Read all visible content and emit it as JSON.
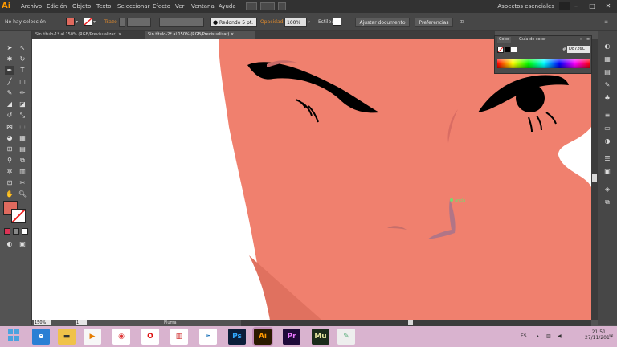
{
  "app": {
    "logo": "Ai",
    "menu": [
      "Archivo",
      "Edición",
      "Objeto",
      "Texto",
      "Seleccionar",
      "Efecto",
      "Ver",
      "Ventana",
      "Ayuda"
    ],
    "workspace": "Aspectos esenciales"
  },
  "control": {
    "selection": "No hay selección",
    "fill_color": "#E06A5E",
    "stroke_label": "Trazo",
    "brush": "Redondo 5 pt.",
    "opacity_label": "Opacidad:",
    "opacity_value": "100%",
    "style_label": "Estilo:",
    "adjust_button": "Ajustar documento",
    "prefs_button": "Preferencias"
  },
  "tabs": [
    {
      "label": "Sin título-1* al 150% (RGB/Previsualizar)",
      "close": "×"
    },
    {
      "label": "Sin título-2* al 150% (RGB/Previsualizar)",
      "close": "×"
    }
  ],
  "color_panel": {
    "tabs": [
      "Color",
      "Guía de color"
    ],
    "hex_symbol": "#",
    "hex_value": "D8726C"
  },
  "status": {
    "zoom": "150%",
    "page": "1",
    "tool": "Pluma"
  },
  "canvas": {
    "skin": "#F0806E",
    "shadow": "#E0715F",
    "anchor_label": "ancla"
  },
  "taskbar": {
    "lang": "ES",
    "time": "21:51",
    "date": "27/11/2017"
  }
}
